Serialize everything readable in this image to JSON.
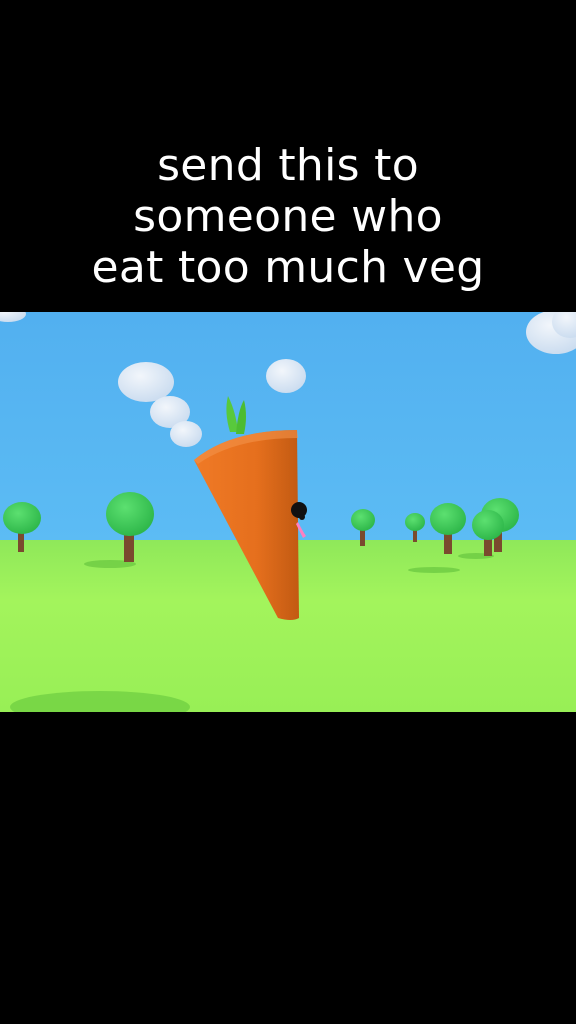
{
  "caption": {
    "lines": [
      "send this to",
      "someone who",
      "eat too much veg"
    ]
  },
  "scene": {
    "sky_color": "#54b4f2",
    "ground_color": "#a2f55a",
    "carrier_color": "#e36f1c",
    "leaf_color": "#58c93c",
    "tree_foliage_color": "#3cc850",
    "tree_trunk_color": "#7a4a2e",
    "cloud_color": "#dde9f6"
  }
}
